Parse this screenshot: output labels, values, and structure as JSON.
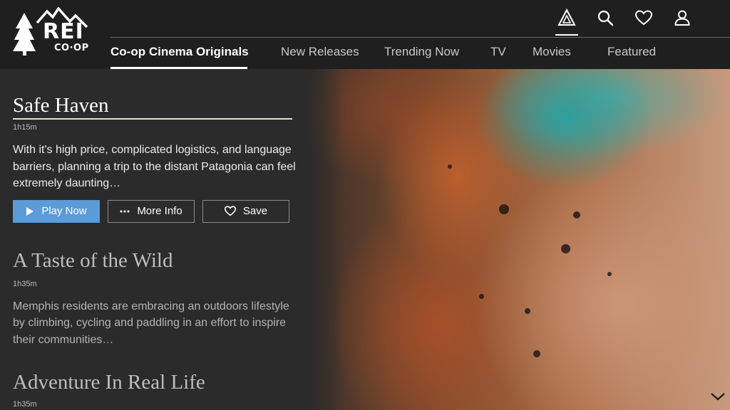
{
  "brand": {
    "name": "REI",
    "sub": "CO·OP"
  },
  "header": {
    "icons": [
      {
        "name": "campfire-icon",
        "active": true
      },
      {
        "name": "search-icon",
        "active": false
      },
      {
        "name": "heart-icon",
        "active": false
      },
      {
        "name": "user-icon",
        "active": false
      }
    ]
  },
  "nav": {
    "tabs": [
      {
        "label": "Co-op Cinema Originals",
        "active": true
      },
      {
        "label": "New Releases",
        "active": false
      },
      {
        "label": "Trending Now",
        "active": false
      },
      {
        "label": "TV",
        "active": false
      },
      {
        "label": "Movies",
        "active": false
      },
      {
        "label": "Featured",
        "active": false
      }
    ]
  },
  "items": [
    {
      "title": "Safe Haven",
      "duration": "1h15m",
      "description": "With it's high price, complicated logistics, and language barriers, planning a trip to the distant Patagonia can feel extremely daunting…",
      "focused": true,
      "actions": {
        "play": "Play Now",
        "info": "More Info",
        "save": "Save"
      }
    },
    {
      "title": "A Taste of the Wild",
      "duration": "1h35m",
      "description": "Memphis residents are embracing an outdoors lifestyle by climbing, cycling and paddling in an effort to inspire their communities…"
    },
    {
      "title": "Adventure In Real Life",
      "duration": "1h35m"
    }
  ],
  "colors": {
    "accent": "#5b9bd8",
    "header_bg": "#1f1f1f",
    "panel_bg": "#2b2b2b",
    "title_rule": "#e8dfc4"
  }
}
